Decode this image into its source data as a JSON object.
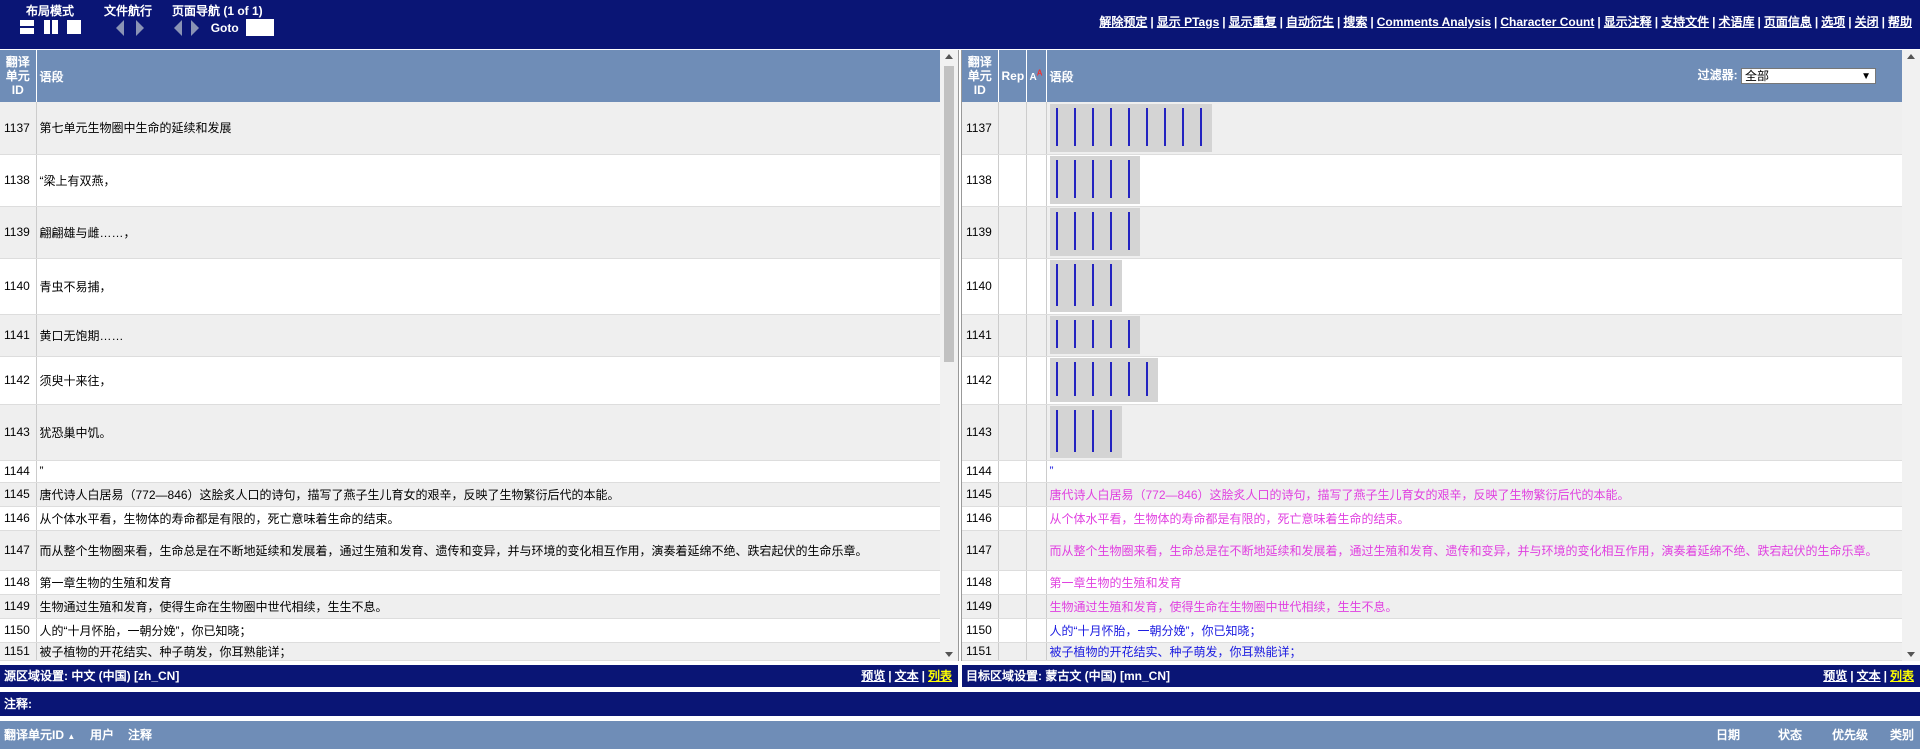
{
  "toolbar": {
    "layout_mode": "布局模式",
    "file_nav": "文件航行",
    "page_nav": "页面导航 (1 of 1)",
    "goto": "Goto",
    "links": [
      "解除预定",
      "显示 PTags",
      "显示重复",
      "自动衍生",
      "搜索",
      "Comments Analysis",
      "Character Count",
      "显示注释",
      "支持文件",
      "术语库",
      "页面信息",
      "选项",
      "关闭",
      "帮助"
    ]
  },
  "left_pane": {
    "headers": {
      "id": "翻译单元ID",
      "segment": "语段"
    },
    "rows": [
      {
        "id": "1137",
        "text": "第七单元生物圈中生命的延续和发展"
      },
      {
        "id": "1138",
        "text": "“梁上有双燕，"
      },
      {
        "id": "1139",
        "text": "翩翩雄与雌……，"
      },
      {
        "id": "1140",
        "text": "青虫不易捕，"
      },
      {
        "id": "1141",
        "text": "黄口无饱期……"
      },
      {
        "id": "1142",
        "text": "须臾十来往，"
      },
      {
        "id": "1143",
        "text": "犹恐巢中饥。"
      },
      {
        "id": "1144",
        "text": "”"
      },
      {
        "id": "1145",
        "text": "唐代诗人白居易（772—846）这脍炙人口的诗句，描写了燕子生儿育女的艰辛，反映了生物繁衍后代的本能。"
      },
      {
        "id": "1146",
        "text": "从个体水平看，生物体的寿命都是有限的，死亡意味着生命的结束。"
      },
      {
        "id": "1147",
        "text": "而从整个生物圈来看，生命总是在不断地延续和发展着，通过生殖和发育、遗传和变异，并与环境的变化相互作用，演奏着延绵不绝、跌宕起伏的生命乐章。"
      },
      {
        "id": "1148",
        "text": "第一章生物的生殖和发育"
      },
      {
        "id": "1149",
        "text": "生物通过生殖和发育，使得生命在生物圈中世代相续，生生不息。"
      },
      {
        "id": "1150",
        "text": "人的“十月怀胎，一朝分娩”，你已知晓；"
      },
      {
        "id": "1151",
        "text": "被子植物的开花结实、种子萌发，你耳熟能详；"
      }
    ],
    "status_label": "源区域设置: 中文 (中国) [zh_CN]",
    "status_links": [
      "预览",
      "文本",
      "列表"
    ]
  },
  "right_pane": {
    "headers": {
      "id": "翻译单元ID",
      "rep": "Rep",
      "segment": "语段"
    },
    "filter_label": "过滤器:",
    "filter_value": "全部",
    "rows": [
      {
        "id": "1137",
        "text": ""
      },
      {
        "id": "1138",
        "text": ""
      },
      {
        "id": "1139",
        "text": ""
      },
      {
        "id": "1140",
        "text": ""
      },
      {
        "id": "1141",
        "text": ""
      },
      {
        "id": "1142",
        "text": ""
      },
      {
        "id": "1143",
        "text": ""
      },
      {
        "id": "1144",
        "text": "”"
      },
      {
        "id": "1145",
        "text": "唐代诗人白居易（772—846）这脍炙人口的诗句，描写了燕子生儿育女的艰辛，反映了生物繁衍后代的本能。"
      },
      {
        "id": "1146",
        "text": "从个体水平看，生物体的寿命都是有限的，死亡意味着生命的结束。"
      },
      {
        "id": "1147",
        "text": "而从整个生物圈来看，生命总是在不断地延续和发展着，通过生殖和发育、遗传和变异，并与环境的变化相互作用，演奏着延绵不绝、跌宕起伏的生命乐章。"
      },
      {
        "id": "1148",
        "text": "第一章生物的生殖和发育"
      },
      {
        "id": "1149",
        "text": "生物通过生殖和发育，使得生命在生物圈中世代相续，生生不息。"
      },
      {
        "id": "1150",
        "text": "人的“十月怀胎，一朝分娩”，你已知晓；"
      },
      {
        "id": "1151",
        "text": "被子植物的开花结实、种子萌发，你耳熟能详；"
      }
    ],
    "status_label": "目标区域设置: 蒙古文 (中国) [mn_CN]",
    "status_links": [
      "预览",
      "文本",
      "列表"
    ]
  },
  "notes": {
    "label": "注释:",
    "columns_left": [
      "翻译单元ID",
      "用户",
      "注释"
    ],
    "columns_right": [
      "日期",
      "状态",
      "优先级",
      "类别"
    ]
  }
}
